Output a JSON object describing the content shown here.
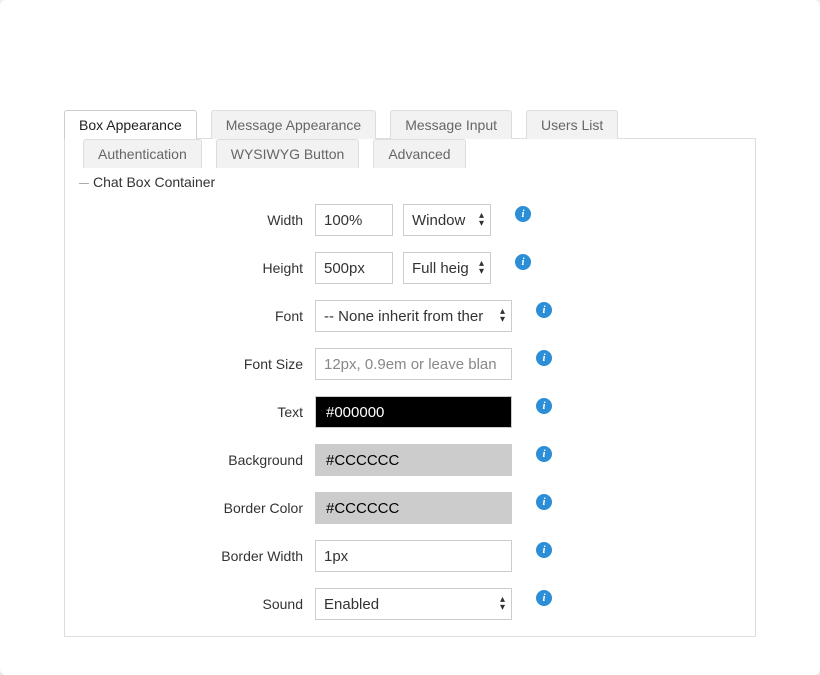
{
  "tabs": {
    "row1": [
      {
        "label": "Box Appearance",
        "active": true
      },
      {
        "label": "Message Appearance",
        "active": false
      },
      {
        "label": "Message Input",
        "active": false
      },
      {
        "label": "Users List",
        "active": false
      }
    ],
    "row2": [
      {
        "label": "Authentication",
        "active": false
      },
      {
        "label": "WYSIWYG Button",
        "active": false
      },
      {
        "label": "Advanced",
        "active": false
      }
    ]
  },
  "fieldset": {
    "title": "Chat Box Container"
  },
  "fields": {
    "width": {
      "label": "Width",
      "value": "100%",
      "unit_selected": "Window"
    },
    "height": {
      "label": "Height",
      "value": "500px",
      "unit_selected": "Full heig"
    },
    "font": {
      "label": "Font",
      "selected": "-- None inherit from ther"
    },
    "fontSize": {
      "label": "Font Size",
      "placeholder": "12px, 0.9em or leave blan",
      "value": ""
    },
    "text": {
      "label": "Text",
      "value": "#000000"
    },
    "background": {
      "label": "Background",
      "value": "#CCCCCC"
    },
    "borderColor": {
      "label": "Border Color",
      "value": "#CCCCCC"
    },
    "borderWidth": {
      "label": "Border Width",
      "value": "1px"
    },
    "sound": {
      "label": "Sound",
      "selected": "Enabled"
    }
  },
  "info_glyph": "i"
}
